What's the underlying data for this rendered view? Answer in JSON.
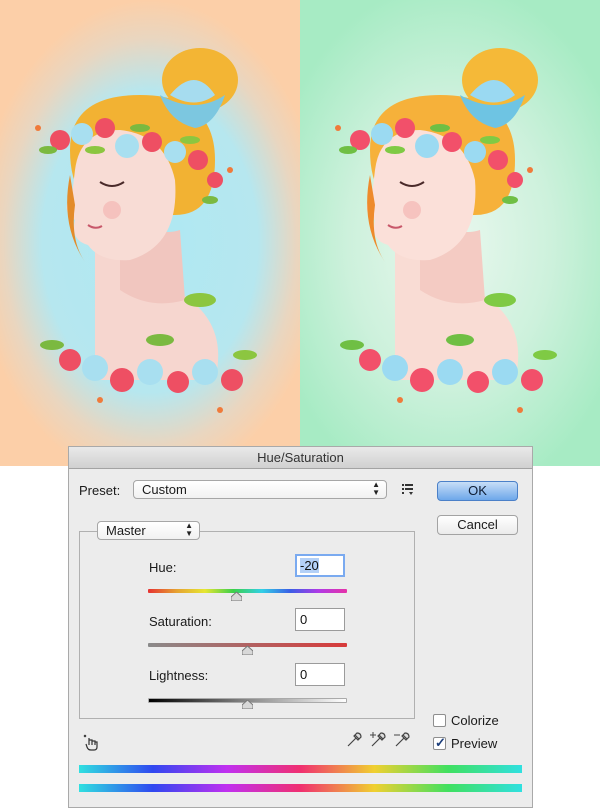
{
  "dialog": {
    "title": "Hue/Saturation",
    "preset_label": "Preset:",
    "preset_value": "Custom",
    "channel_value": "Master",
    "ok_label": "OK",
    "cancel_label": "Cancel",
    "hue": {
      "label": "Hue:",
      "value": "-20",
      "slider_fraction": 0.445
    },
    "saturation": {
      "label": "Saturation:",
      "value": "0",
      "slider_fraction": 0.5
    },
    "lightness": {
      "label": "Lightness:",
      "value": "0",
      "slider_fraction": 0.5
    },
    "colorize": {
      "label": "Colorize",
      "checked": false
    },
    "preview": {
      "label": "Preview",
      "checked": true
    }
  },
  "icons": {
    "preset_menu": "list-menu-icon",
    "targeted_adjust": "hand-pointer-icon",
    "eyedroppers": [
      "eyedropper-icon",
      "eyedropper-plus-icon",
      "eyedropper-minus-icon"
    ]
  },
  "colors": {
    "left_background": "#fccfa8",
    "left_glow": "#aee8f3",
    "right_background": "#a7ebc4",
    "ok_button": "#6ea7ea"
  }
}
